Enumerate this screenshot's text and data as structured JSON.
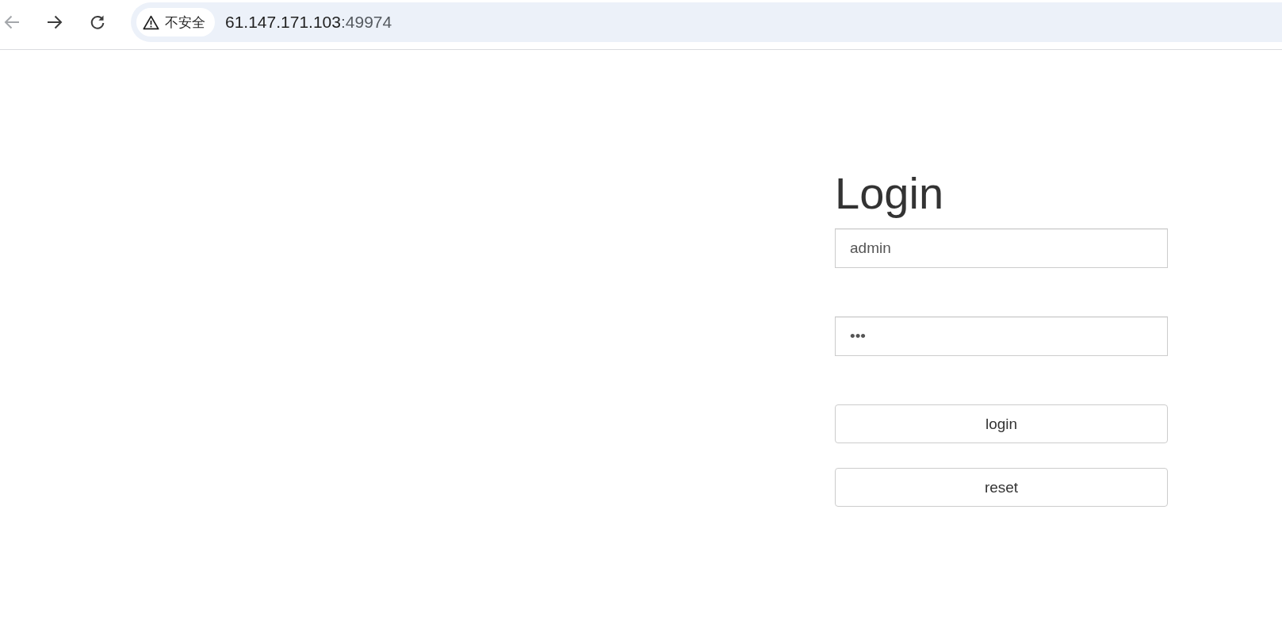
{
  "browser": {
    "nav_buttons": [
      {
        "kind": "back",
        "disabled": true
      },
      {
        "kind": "forward",
        "disabled": false
      },
      {
        "kind": "reload",
        "disabled": false
      }
    ],
    "security_chip": {
      "label": "不安全"
    },
    "address": {
      "host": "61.147.171.103",
      "port": ":49974"
    }
  },
  "login": {
    "title": "Login",
    "username": {
      "value": "admin"
    },
    "password": {
      "value": "•••"
    },
    "buttons": [
      "login",
      "reset"
    ]
  }
}
